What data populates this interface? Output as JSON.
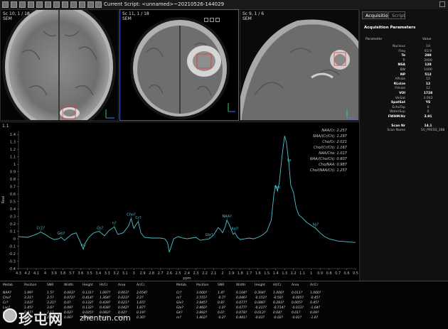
{
  "toolbar": {
    "title": "Current Script: <unnamed>~20210526-144029"
  },
  "viewports": [
    {
      "series": "Sc 10, 1 / 18",
      "sub": "SEM"
    },
    {
      "series": "Sc 11, 1 / 18",
      "sub": "SEM"
    },
    {
      "series": "Sc 9, 1 / 6",
      "sub": "SEM"
    }
  ],
  "side": {
    "tabs": {
      "acquisition": "Acquisition",
      "script": "Script"
    },
    "title": "Acquisition Parameters",
    "col_param": "Parameter",
    "col_value": "Value",
    "params": [
      {
        "name": "Nucleus",
        "value": "1H",
        "bold": false
      },
      {
        "name": "Freq",
        "value": "63.9",
        "bold": false
      },
      {
        "name": "Te",
        "value": "288",
        "bold": true
      },
      {
        "name": "Tr",
        "value": "2000",
        "bold": false
      },
      {
        "name": "NSA",
        "value": "128",
        "bold": true
      },
      {
        "name": "BW",
        "value": "1000",
        "bold": false
      },
      {
        "name": "NP",
        "value": "512",
        "bold": true
      },
      {
        "name": "APsize",
        "value": "12",
        "bold": false
      },
      {
        "name": "RLsize",
        "value": "12",
        "bold": true
      },
      {
        "name": "FHsize",
        "value": "12",
        "bold": false
      },
      {
        "name": "VOI",
        "value": "1728",
        "bold": true
      },
      {
        "name": "VoiSat",
        "value": "3.043",
        "bold": false
      },
      {
        "name": "SpatSat",
        "value": "YS",
        "bold": true
      },
      {
        "name": "EchoTop",
        "value": "0",
        "bold": false
      },
      {
        "name": "WaterSup",
        "value": "0",
        "bold": false
      },
      {
        "name": "FWHM/Hz",
        "value": "3.91",
        "bold": true
      },
      {
        "name": "Scan Nr",
        "value": "14.1",
        "bold": true
      },
      {
        "name": "Scan Name",
        "value": "SV_PRESS_288",
        "bold": false
      }
    ]
  },
  "spectrum": {
    "number": "1.1",
    "ratios": [
      "NAA/Cr: 2.257",
      "NAA/(Cr/Ch): 1.297",
      "Cho/Cr: 2.021",
      "Cho/(Cr/Ch): 1.167",
      "NAA/Cho: 1.017",
      "NAA/(Cho/Ch): 0.607",
      "Cho/NAA: 0.987",
      "Cho/(NAA/Ch): 1.257"
    ],
    "x_ticks": [
      "4.3",
      "4.2",
      "4.1",
      "4",
      "3.9",
      "3.8",
      "3.7",
      "3.6",
      "3.5",
      "3.4",
      "3.3",
      "3.2",
      "3.1",
      "3",
      "2.9",
      "2.8",
      "2.7",
      "2.6",
      "2.5",
      "2.4",
      "2.3",
      "2.2",
      "2.1",
      "2",
      "1.9",
      "1.8",
      "1.7",
      "1.6",
      "1.5",
      "1.4",
      "1.3",
      "1.2",
      "1.1",
      "1",
      "0.9",
      "0.8",
      "0.7",
      "0.6",
      "0.5"
    ],
    "x_label": "ppm",
    "y_ticks": [
      "1.4",
      "1.3",
      "1.2",
      "1.1",
      "1",
      "0.9",
      "0.8",
      "0.7",
      "0.6",
      "0.5",
      "0.4",
      "0.3",
      "0.2",
      "0.1",
      "0",
      "-0.1",
      "-0.2",
      "-0.3",
      "-0.4"
    ],
    "y_label": "Real",
    "peaks": [
      {
        "label": "Cr2?",
        "ppm": 4.05
      },
      {
        "label": "Gkl?",
        "ppm": 3.82
      },
      {
        "label": "Ins",
        "ppm": 3.57
      },
      {
        "label": "Gs?",
        "ppm": 3.38
      },
      {
        "label": "n?",
        "ppm": 3.22
      },
      {
        "label": "Cho?",
        "ppm": 3.03
      },
      {
        "label": "Cr?",
        "ppm": 2.95
      },
      {
        "label": "Glx?",
        "ppm": 2.15
      },
      {
        "label": "NAA?",
        "ppm": 1.95
      },
      {
        "label": "Asl?",
        "ppm": 1.86
      },
      {
        "label": "Lac",
        "ppm": 1.38
      },
      {
        "label": "lip",
        "ppm": 1.25
      },
      {
        "label": "lip?",
        "ppm": 0.95
      }
    ]
  },
  "chart_data": {
    "type": "line",
    "title": "",
    "xlabel": "ppm",
    "ylabel": "Real",
    "xlim": [
      4.3,
      0.5
    ],
    "ylim": [
      -0.4,
      1.45
    ],
    "x": [
      4.3,
      4.2,
      4.1,
      4.05,
      4.0,
      3.95,
      3.9,
      3.85,
      3.82,
      3.78,
      3.7,
      3.65,
      3.6,
      3.57,
      3.55,
      3.5,
      3.45,
      3.4,
      3.38,
      3.33,
      3.28,
      3.22,
      3.18,
      3.12,
      3.06,
      3.03,
      3.0,
      2.97,
      2.95,
      2.92,
      2.88,
      2.8,
      2.7,
      2.65,
      2.62,
      2.6,
      2.55,
      2.5,
      2.45,
      2.4,
      2.35,
      2.3,
      2.25,
      2.2,
      2.15,
      2.1,
      2.05,
      2.02,
      2.0,
      1.97,
      1.95,
      1.92,
      1.9,
      1.88,
      1.86,
      1.83,
      1.8,
      1.75,
      1.7,
      1.65,
      1.6,
      1.55,
      1.5,
      1.45,
      1.42,
      1.4,
      1.38,
      1.36,
      1.33,
      1.3,
      1.28,
      1.25,
      1.23,
      1.2,
      1.17,
      1.14,
      1.1,
      1.05,
      1.0,
      0.95,
      0.9,
      0.85,
      0.8,
      0.7,
      0.6,
      0.5
    ],
    "y": [
      0.03,
      0.02,
      0.06,
      0.09,
      0.06,
      0.02,
      -0.01,
      0.0,
      0.02,
      -0.02,
      0.06,
      0.08,
      -0.05,
      -0.14,
      -0.06,
      0.03,
      0.08,
      0.1,
      0.09,
      0.04,
      0.11,
      0.16,
      0.06,
      0.08,
      0.17,
      0.27,
      0.14,
      0.2,
      0.23,
      0.08,
      0.02,
      0.01,
      0.01,
      0.0,
      -0.05,
      -0.18,
      0.0,
      0.03,
      0.01,
      0.0,
      0.01,
      0.02,
      -0.02,
      -0.01,
      0.0,
      0.05,
      0.15,
      0.12,
      0.08,
      0.16,
      0.25,
      0.18,
      0.12,
      0.06,
      0.08,
      0.02,
      -0.01,
      0.0,
      0.01,
      0.0,
      0.02,
      0.05,
      0.1,
      0.25,
      0.6,
      0.72,
      0.64,
      0.75,
      1.1,
      1.38,
      1.3,
      1.0,
      0.72,
      0.62,
      0.42,
      0.32,
      0.28,
      0.22,
      0.18,
      0.14,
      0.08,
      0.03,
      0.0,
      -0.03,
      -0.04,
      -0.05
    ]
  },
  "table": {
    "headers": [
      "Metab",
      "Position",
      "SNR",
      "Width",
      "Height",
      "Ht/Cr",
      "Area",
      "Ar/Cr"
    ],
    "left_rows": [
      [
        "NAA?",
        "1.99?",
        "1.5?",
        "0.063?",
        "0.131?",
        "1.097?",
        "0.063?",
        "2.054?"
      ],
      [
        "Cho?",
        "3.21?",
        "2.5?",
        "0.072?",
        "0.414?",
        "1.364?",
        "0.023?",
        "2.2?"
      ],
      [
        "Cr?",
        "3.03?",
        "3.21?",
        "0.0?",
        "0.132?",
        "0.439?",
        "0.021?",
        "1.65?"
      ],
      [
        "Lac?",
        "1.45?",
        "3.6?",
        "0.09?",
        "0.132?",
        "0.438?",
        "0.042?",
        "1.87?"
      ],
      [
        "Lip?",
        "0.97?",
        "2.1?",
        "0.02?",
        "0.025?",
        "0.083?",
        "0.02?",
        "0.19?"
      ],
      [
        "Ins?",
        "3.54?",
        "2.2?",
        "0.06?",
        "0.042?",
        "0.14?",
        "0.01?",
        "0.30?"
      ]
    ],
    "right_rows": [
      [
        "Cr?",
        "3.000?",
        "1.4?",
        "0.104?",
        "0.304?",
        "1.000?",
        "0.011?",
        "1.000?"
      ],
      [
        "m?",
        "3.555?",
        "-0.7?",
        "0.046?",
        "-0.152?",
        "-0.50?",
        "-0.005?",
        "-0.45?"
      ],
      [
        "Glx?",
        "3.845?",
        "0.8?",
        "0.077?",
        "0.086?",
        "0.283?",
        "0.005?",
        "0.45?"
      ],
      [
        "Glx?",
        "2.460?",
        "-1.0?",
        "0.077?",
        "-0.217?",
        "-0.714?",
        "-0.013?",
        "-1.64?"
      ],
      [
        "Gk?",
        "3.892?",
        "0.0?",
        "0.078?",
        "0.013?",
        "0.04?",
        "0.01?",
        "0.09?"
      ],
      [
        "m?",
        "1.402?",
        "-0.2?",
        "0.441?",
        "-0.03?",
        "-0.02?",
        "-0.01?",
        "-1.6?"
      ]
    ]
  },
  "watermark": {
    "text": "珍屯网",
    "url": "zhentun.com"
  },
  "colors": {
    "trace": "#4fc3ce",
    "roi": "#e53935",
    "axis_green": "#34d04a",
    "axis_blue": "#3b7bff"
  }
}
